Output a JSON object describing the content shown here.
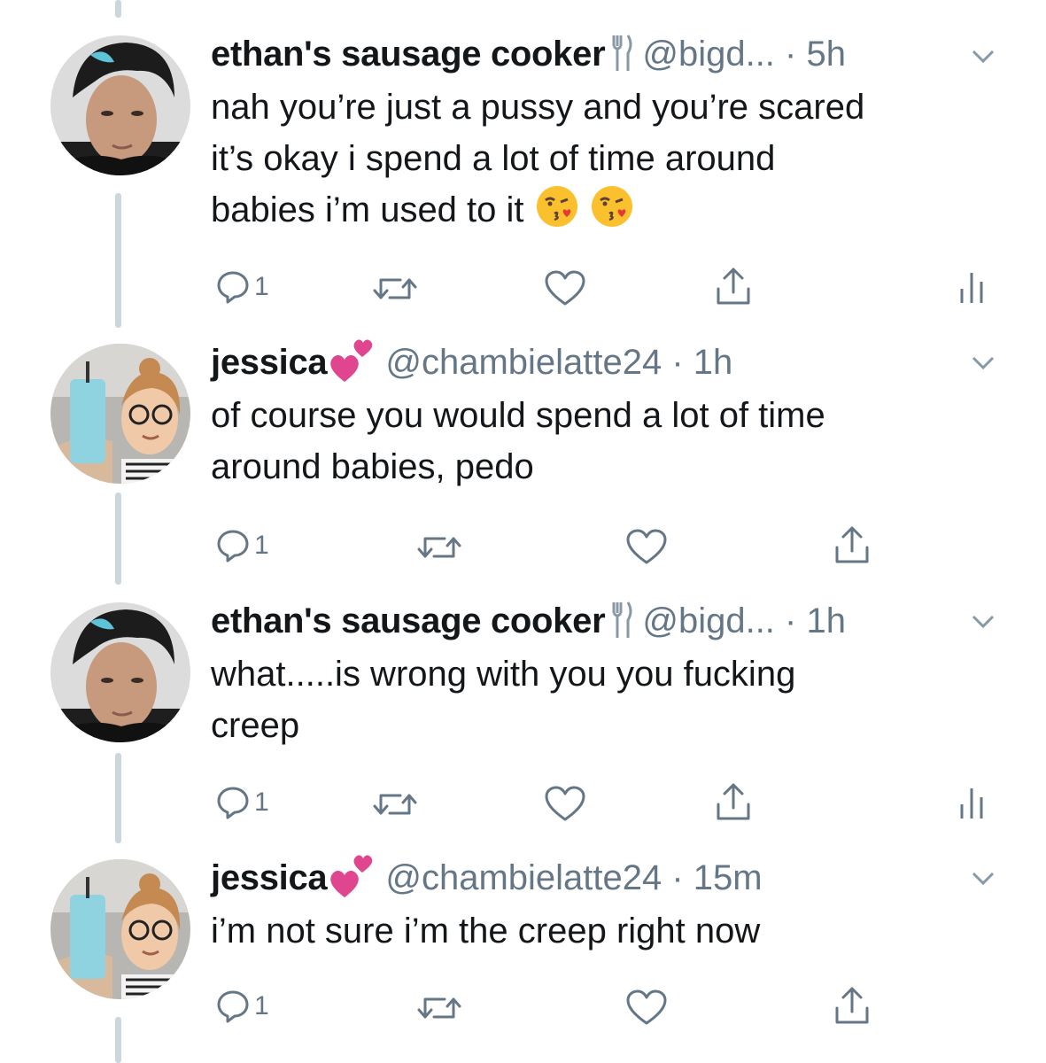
{
  "colors": {
    "text": "#14171a",
    "muted": "#657786",
    "thread_line": "#ccd6dd",
    "heart_emoji": "#e0458f"
  },
  "tweets": [
    {
      "name": "ethan's sausage cooker",
      "name_emoji": "fork-and-knife-icon",
      "handle_time": "@bigd... · 5h",
      "lines": [
        "nah you’re just a pussy and you’re scared",
        "it’s okay i spend a lot of time around",
        "babies i’m used to it"
      ],
      "trailing_emoji": "kissing-face-emoji",
      "reply_count": "1",
      "analytics": true
    },
    {
      "name": "jessica",
      "name_emoji": "two-hearts-emoji",
      "handle_time": "@chambielatte24 · 1h",
      "lines": [
        "of course you would spend a lot of time",
        "around babies, pedo"
      ],
      "reply_count": "1",
      "analytics": false
    },
    {
      "name": "ethan's sausage cooker",
      "name_emoji": "fork-and-knife-icon",
      "handle_time": "@bigd... · 1h",
      "lines": [
        "what.....is wrong with you you fucking",
        "creep"
      ],
      "reply_count": "1",
      "analytics": true
    },
    {
      "name": "jessica",
      "name_emoji": "two-hearts-emoji",
      "handle_time": "@chambielatte24 · 15m",
      "lines": [
        "i’m not sure i’m the creep right now"
      ],
      "reply_count": "1",
      "analytics": false
    }
  ]
}
